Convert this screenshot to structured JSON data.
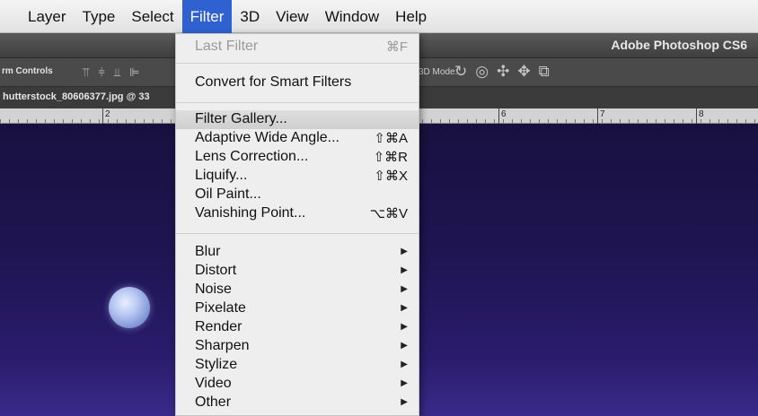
{
  "menubar": {
    "items": [
      {
        "label": "Layer"
      },
      {
        "label": "Type"
      },
      {
        "label": "Select"
      },
      {
        "label": "Filter"
      },
      {
        "label": "3D"
      },
      {
        "label": "View"
      },
      {
        "label": "Window"
      },
      {
        "label": "Help"
      }
    ],
    "active": "Filter"
  },
  "app": {
    "title": "Adobe Photoshop CS6"
  },
  "options_bar": {
    "label": "rm Controls",
    "mode_3d_label": "3D Mode:",
    "align_icons": [
      "align-top-icon",
      "align-vcenter-icon",
      "align-bottom-icon",
      "align-left-icon"
    ],
    "icons_3d": [
      "orbit-icon",
      "roll-icon",
      "pan-icon",
      "slide-icon",
      "scale-icon"
    ]
  },
  "document": {
    "tab_name": "hutterstock_80606377.jpg @ 33"
  },
  "ruler": {
    "numbers": [
      "2",
      "6",
      "7",
      "8"
    ]
  },
  "filter_menu": {
    "last_filter": {
      "label": "Last Filter",
      "shortcut": "⌘F"
    },
    "convert": {
      "label": "Convert for Smart Filters"
    },
    "items": [
      {
        "label": "Filter Gallery...",
        "shortcut": ""
      },
      {
        "label": "Adaptive Wide Angle...",
        "shortcut": "⇧⌘A"
      },
      {
        "label": "Lens Correction...",
        "shortcut": "⇧⌘R"
      },
      {
        "label": "Liquify...",
        "shortcut": "⇧⌘X"
      },
      {
        "label": "Oil Paint...",
        "shortcut": ""
      },
      {
        "label": "Vanishing Point...",
        "shortcut": "⌥⌘V"
      }
    ],
    "submenus": [
      {
        "label": "Blur"
      },
      {
        "label": "Distort"
      },
      {
        "label": "Noise"
      },
      {
        "label": "Pixelate"
      },
      {
        "label": "Render"
      },
      {
        "label": "Sharpen"
      },
      {
        "label": "Stylize"
      },
      {
        "label": "Video"
      },
      {
        "label": "Other"
      }
    ],
    "highlighted": "Filter Gallery..."
  },
  "colors": {
    "menu_highlight": "#2f62d0",
    "canvas_sky": "#1f1552"
  }
}
